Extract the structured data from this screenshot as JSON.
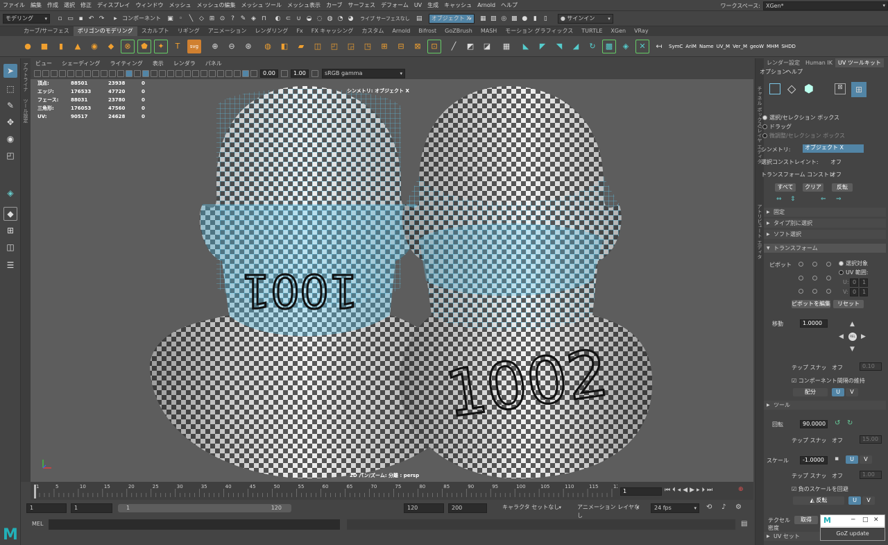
{
  "menubar": {
    "items": [
      "ファイル",
      "編集",
      "作成",
      "選択",
      "修正",
      "ディスプレイ",
      "ウィンドウ",
      "メッシュ",
      "メッシュの編集",
      "メッシュ ツール",
      "メッシュ表示",
      "カーブ",
      "サーフェス",
      "デフォーム",
      "UV",
      "生成",
      "キャッシュ",
      "Arnold",
      "ヘルプ"
    ],
    "workspace_label": "ワークスペース:",
    "workspace_value": "XGen*"
  },
  "toolbar": {
    "mode_value": "モデリング",
    "component_label": "コンポーネント",
    "live_surface": "ライブ サーフェスなし",
    "object_x": "オブジェクト X",
    "signin": "サインイン"
  },
  "shelf": {
    "tabs": [
      "カーブ/サーフェス",
      "ポリゴンのモデリング",
      "スカルプト",
      "リギング",
      "アニメーション",
      "レンダリング",
      "Fx",
      "FX キャッシング",
      "カスタム",
      "Arnold",
      "Bifrost",
      "GoZBrush",
      "MASH",
      "モーション グラフィックス",
      "TURTLE",
      "XGen",
      "VRay"
    ],
    "active_tab": "ポリゴンのモデリング",
    "text_buttons": [
      "SymC",
      "AriM",
      "Name",
      "UV_M",
      "Ver_M",
      "geoW",
      "MHM",
      "SHDD"
    ]
  },
  "side_strip": {
    "labels": [
      "アウトライナ",
      "ツール設定"
    ]
  },
  "viewport": {
    "menu": [
      "ビュー",
      "シェーディング",
      "ライティング",
      "表示",
      "レンダラ",
      "パネル"
    ],
    "exposure": "0.00",
    "gamma": "1.00",
    "colorspace": "sRGB gamma",
    "symmetry_label": "シンメトリ: オブジェクト X",
    "camera_label": "2D パン/ズーム: 分離 : persp",
    "stats": [
      {
        "label": "頂点:",
        "a": "88501",
        "b": "23938",
        "c": "0"
      },
      {
        "label": "エッジ:",
        "a": "176533",
        "b": "47720",
        "c": "0"
      },
      {
        "label": "フェース:",
        "a": "88031",
        "b": "23780",
        "c": "0"
      },
      {
        "label": "三角形:",
        "a": "176053",
        "b": "47560",
        "c": "0"
      },
      {
        "label": "UV:",
        "a": "90517",
        "b": "24628",
        "c": "0"
      }
    ],
    "texts": {
      "left_tile": "1001",
      "right_tile": "1002"
    }
  },
  "timeline": {
    "ticks": [
      "1",
      "5",
      "10",
      "15",
      "20",
      "25",
      "30",
      "35",
      "40",
      "45",
      "50",
      "55",
      "60",
      "65",
      "70",
      "75",
      "80",
      "85",
      "90",
      "95",
      "100",
      "105",
      "110",
      "115",
      "120"
    ],
    "current_frame": "1"
  },
  "range": {
    "start": "1",
    "playback_start": "1",
    "slider_start": "1",
    "slider_end": "120",
    "playback_end": "120",
    "end": "200",
    "character_set": "キャラクタ セットなし",
    "anim_layer": "アニメーション レイヤなし",
    "fps": "24 fps"
  },
  "cmd": {
    "label": "MEL"
  },
  "right_panel": {
    "tabs": [
      "レンダー設定",
      "Human IK",
      "UV ツールキット"
    ],
    "active_tab": "UV ツールキット",
    "strip_labels": [
      "チャネル ボックス/レイヤ エディタ",
      "アトリビュート エディタ"
    ],
    "submenu": [
      "オプション",
      "ヘルプ"
    ],
    "select_options": [
      "選択/セレクション ボックス",
      "ドラッグ",
      "微調整/セレクション ボックス"
    ],
    "symmetry_label": "シンメトリ:",
    "symmetry_value": "オブジェクト X",
    "constraint_label": "選択コンストレイント:",
    "constraint_value": "オフ",
    "transform_constraint_label": "トランスフォーム コンストレ",
    "transform_constraint_value": "オフ",
    "btn_all": "すべて",
    "btn_clear": "クリア",
    "btn_invert": "反転",
    "sections": [
      "固定",
      "タイプ別に選択",
      "ソフト選択",
      "トランスフォーム",
      "ツール",
      "UV セット"
    ],
    "pivot_label": "ピボット",
    "pivot_sel": "選択対象",
    "pivot_uv": "UV 範囲:",
    "u_label": "U:",
    "v_label": "V:",
    "uv_zero": "0",
    "uv_one": "1",
    "btn_edit_pivot": "ピボットを編集",
    "btn_reset": "リセット",
    "move_label": "移動",
    "move_value": "1.0000",
    "rel_label": "REL",
    "snap_label": "テップ スナッ",
    "snap_off": "オフ",
    "snap1": "0.10",
    "keep_spacing": "コンポーネント間隔の維持",
    "distribute": "配分",
    "u": "U",
    "v": "V",
    "rotate_label": "回転",
    "rotate_value": "90.0000",
    "snap2": "15.00",
    "scale_label": "スケール",
    "scale_value": "-1.0000",
    "snap3": "1.00",
    "avoid_neg": "負のスケールを回避",
    "flip": "反転",
    "texel_label": "テクセル密度",
    "get": "取得"
  },
  "popup": {
    "title_glyph": "M",
    "button": "GoZ update"
  },
  "colors": {
    "accent_blue": "#5285a6",
    "wire": "#5cc8f0",
    "logo_teal": "#22b0b8"
  }
}
